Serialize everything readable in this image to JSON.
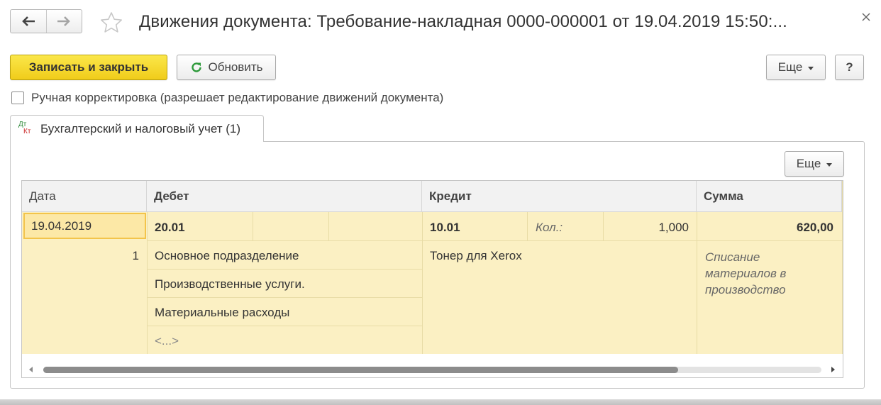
{
  "window": {
    "title": "Движения документа: Требование-накладная 0000-000001 от 19.04.2019 15:50:...",
    "back_icon": "arrow-left-icon",
    "forward_icon": "arrow-right-icon",
    "favorite_icon": "star-icon",
    "close_icon": "close-icon"
  },
  "toolbar": {
    "save_close_label": "Записать и закрыть",
    "refresh_label": "Обновить",
    "more_label": "Еще",
    "help_label": "?"
  },
  "manual_edit": {
    "label": "Ручная корректировка (разрешает редактирование движений документа)",
    "checked": false
  },
  "tab": {
    "label": "Бухгалтерский и налоговый учет (1)",
    "icon_dt": "Дт",
    "icon_kt": "Кт"
  },
  "grid": {
    "more_label": "Еще",
    "columns": {
      "date": "Дата",
      "debit": "Дебет",
      "credit": "Кредит",
      "sum": "Сумма"
    },
    "row": {
      "date": "19.04.2019",
      "line_number": "1",
      "debit_account": "20.01",
      "debit_subconto": [
        "Основное подразделение",
        "Производственные услуги.",
        "Материальные расходы",
        "<...>"
      ],
      "credit_account": "10.01",
      "qty_label": "Кол.:",
      "qty_value": "1,000",
      "credit_subconto": [
        "Тонер для Xerox"
      ],
      "sum": "620,00",
      "content": [
        "Списание",
        "материалов в",
        "производство"
      ]
    }
  },
  "colors": {
    "primary_button": "#f5d633",
    "row_highlight": "#fbf0c3",
    "selected_cell": "#fce8a6"
  }
}
